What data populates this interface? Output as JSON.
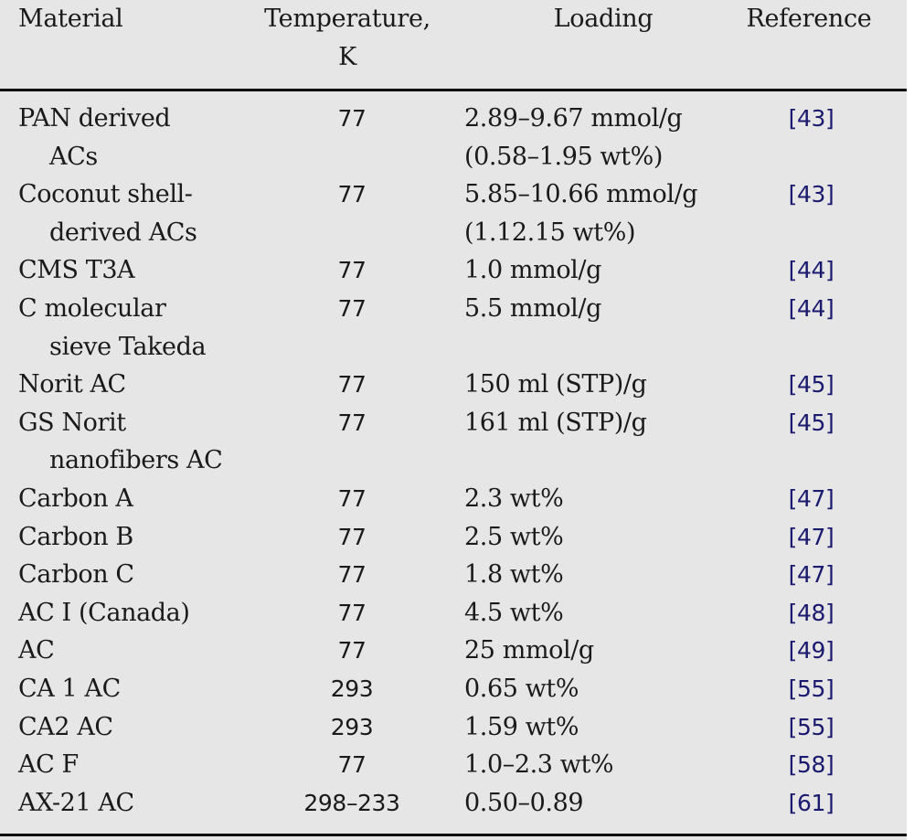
{
  "table": {
    "columns": {
      "material": "Material",
      "temperature_line1": "Temperature,",
      "temperature_line2": "K",
      "loading": "Loading",
      "reference": "Reference"
    },
    "rows": [
      {
        "material": [
          "PAN derived",
          "ACs"
        ],
        "temperature": "77",
        "loading": [
          "2.89–9.67 mmol/g",
          "(0.58–1.95 wt%)"
        ],
        "reference": "[43]"
      },
      {
        "material": [
          "Coconut shell-",
          "derived ACs"
        ],
        "temperature": "77",
        "loading": [
          "5.85–10.66 mmol/g",
          "(1.12.15 wt%)"
        ],
        "reference": "[43]"
      },
      {
        "material": [
          "CMS T3A"
        ],
        "temperature": "77",
        "loading": [
          "1.0 mmol/g"
        ],
        "reference": "[44]"
      },
      {
        "material": [
          "C molecular",
          "sieve Takeda"
        ],
        "temperature": "77",
        "loading": [
          "5.5 mmol/g"
        ],
        "reference": "[44]"
      },
      {
        "material": [
          "Norit AC"
        ],
        "temperature": "77",
        "loading": [
          "150 ml (STP)/g"
        ],
        "reference": "[45]"
      },
      {
        "material": [
          "GS Norit",
          "nanofibers AC"
        ],
        "temperature": "77",
        "loading": [
          "161 ml (STP)/g"
        ],
        "reference": "[45]"
      },
      {
        "material": [
          "Carbon A"
        ],
        "temperature": "77",
        "loading": [
          "2.3 wt%"
        ],
        "reference": "[47]"
      },
      {
        "material": [
          "Carbon B"
        ],
        "temperature": "77",
        "loading": [
          "2.5 wt%"
        ],
        "reference": "[47]"
      },
      {
        "material": [
          "Carbon C"
        ],
        "temperature": "77",
        "loading": [
          "1.8 wt%"
        ],
        "reference": "[47]"
      },
      {
        "material": [
          "AC I (Canada)"
        ],
        "temperature": "77",
        "loading": [
          "4.5 wt%"
        ],
        "reference": "[48]"
      },
      {
        "material": [
          "AC"
        ],
        "temperature": "77",
        "loading": [
          "25 mmol/g"
        ],
        "reference": "[49]"
      },
      {
        "material": [
          "CA 1 AC"
        ],
        "temperature": "293",
        "loading": [
          "0.65 wt%"
        ],
        "reference": "[55]"
      },
      {
        "material": [
          "CA2 AC"
        ],
        "temperature": "293",
        "loading": [
          "1.59 wt%"
        ],
        "reference": "[55]"
      },
      {
        "material": [
          "AC F"
        ],
        "temperature": "77",
        "loading": [
          "1.0–2.3 wt%"
        ],
        "reference": "[58]"
      },
      {
        "material": [
          "AX-21 AC"
        ],
        "temperature": "298–233",
        "loading": [
          "0.50–0.89"
        ],
        "reference": "[61]"
      }
    ]
  },
  "colors": {
    "background": "#e6e6e6",
    "text": "#1a1a1a",
    "reference_link": "#1a1a6e",
    "rule": "#000000"
  }
}
